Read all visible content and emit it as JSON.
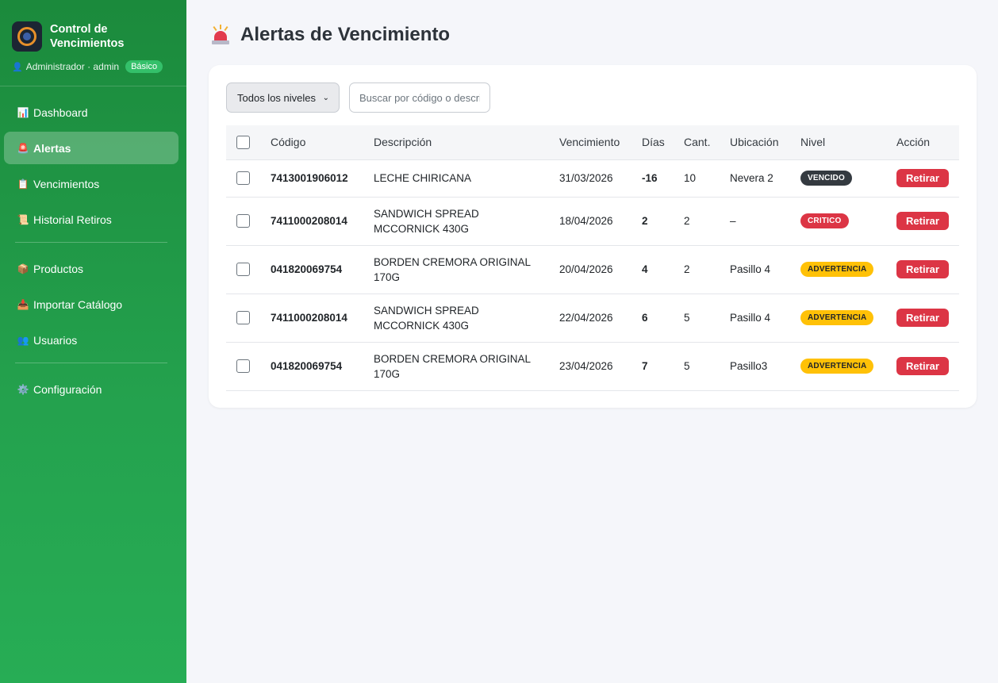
{
  "sidebar": {
    "brand_title_line1": "Control de",
    "brand_title_line2": "Vencimientos",
    "user_label": "Administrador · admin",
    "plan_badge": "Básico",
    "items": [
      {
        "label": "Dashboard",
        "icon": "bar-chart-icon"
      },
      {
        "label": "Alertas",
        "icon": "siren-icon",
        "active": true
      },
      {
        "label": "Vencimientos",
        "icon": "clipboard-icon"
      },
      {
        "label": "Historial Retiros",
        "icon": "scroll-icon"
      },
      {
        "label": "Productos",
        "icon": "package-icon"
      },
      {
        "label": "Importar Catálogo",
        "icon": "inbox-icon"
      },
      {
        "label": "Usuarios",
        "icon": "users-icon"
      },
      {
        "label": "Configuración",
        "icon": "gear-icon"
      }
    ]
  },
  "page": {
    "title": "Alertas de Vencimiento"
  },
  "filters": {
    "level_select_value": "Todos los niveles",
    "search_placeholder": "Buscar por código o descri"
  },
  "table": {
    "headers": {
      "code": "Código",
      "description": "Descripción",
      "expiry": "Vencimiento",
      "days": "Días",
      "qty": "Cant.",
      "location": "Ubicación",
      "level": "Nivel",
      "action": "Acción"
    },
    "rows": [
      {
        "code": "7413001906012",
        "desc1": "LECHE CHIRICANA",
        "desc2": "",
        "expiry": "31/03/2026",
        "days": "-16",
        "qty": "10",
        "location": "Nevera 2",
        "level": "VENCIDO",
        "action": "Retirar"
      },
      {
        "code": "7411000208014",
        "desc1": "SANDWICH SPREAD",
        "desc2": "MCCORNICK 430G",
        "expiry": "18/04/2026",
        "days": "2",
        "qty": "2",
        "location": "–",
        "level": "CRITICO",
        "action": "Retirar"
      },
      {
        "code": "041820069754",
        "desc1": "BORDEN CREMORA ORIGINAL",
        "desc2": "170G",
        "expiry": "20/04/2026",
        "days": "4",
        "qty": "2",
        "location": "Pasillo 4",
        "level": "ADVERTENCIA",
        "action": "Retirar"
      },
      {
        "code": "7411000208014",
        "desc1": "SANDWICH SPREAD",
        "desc2": "MCCORNICK 430G",
        "expiry": "22/04/2026",
        "days": "6",
        "qty": "5",
        "location": "Pasillo 4",
        "level": "ADVERTENCIA",
        "action": "Retirar"
      },
      {
        "code": "041820069754",
        "desc1": "BORDEN CREMORA ORIGINAL",
        "desc2": "170G",
        "expiry": "23/04/2026",
        "days": "7",
        "qty": "5",
        "location": "Pasillo3",
        "level": "ADVERTENCIA",
        "action": "Retirar"
      }
    ]
  },
  "colors": {
    "sidebar_green": "#1b8a3c",
    "vencido": "#343a40",
    "critico": "#dc3545",
    "advertencia": "#ffc107",
    "retirar_button": "#dc3545"
  }
}
